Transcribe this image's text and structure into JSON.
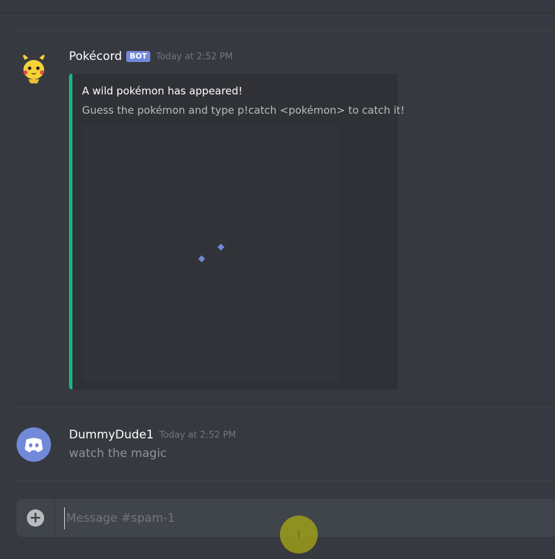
{
  "messages": [
    {
      "username": "Pokécord",
      "tag": "BOT",
      "timestamp": "Today at 2:52 PM",
      "embed": {
        "title": "A wild pokémon has appeared!",
        "description": "Guess the pokémon and type p!catch <pokémon> to catch it!"
      }
    },
    {
      "username": "DummyDude1",
      "timestamp": "Today at 2:52 PM",
      "text": "watch the magic"
    }
  ],
  "composer": {
    "placeholder": "Message #spam-1",
    "value": ""
  },
  "icons": {
    "add": "plus-circle-icon",
    "cursor": "text-cursor-icon"
  },
  "colors": {
    "background": "#36393f",
    "embed_accent": "#10b981",
    "bot_tag": "#7289da",
    "discord_blurple": "#7289da"
  }
}
